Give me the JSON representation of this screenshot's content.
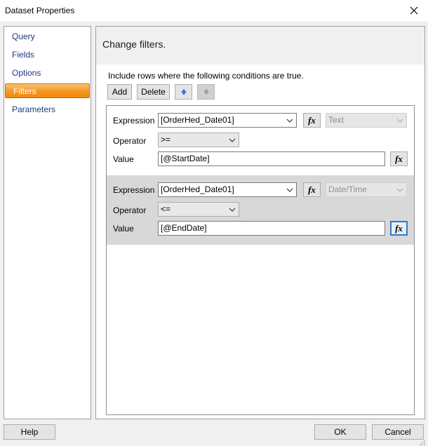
{
  "window": {
    "title": "Dataset Properties"
  },
  "nav": {
    "items": [
      {
        "label": "Query"
      },
      {
        "label": "Fields"
      },
      {
        "label": "Options"
      },
      {
        "label": "Filters",
        "selected": true
      },
      {
        "label": "Parameters"
      }
    ]
  },
  "panel": {
    "header": "Change filters.",
    "instructions": "Include rows where the following conditions are true."
  },
  "toolbar": {
    "add_label": "Add",
    "delete_label": "Delete",
    "move_up_icon": "arrow-up-icon",
    "move_down_icon": "arrow-down-icon"
  },
  "filters": [
    {
      "expression_label": "Expression",
      "expression_value": "[OrderHed_Date01]",
      "type_value": "Text",
      "operator_label": "Operator",
      "operator_value": ">=",
      "value_label": "Value",
      "value_value": "[@StartDate]",
      "fx_label": "fx"
    },
    {
      "expression_label": "Expression",
      "expression_value": "[OrderHed_Date01]",
      "type_value": "Date/Time",
      "operator_label": "Operator",
      "operator_value": "<=",
      "value_label": "Value",
      "value_value": "[@EndDate]",
      "fx_label": "fx"
    }
  ],
  "footer": {
    "help_label": "Help",
    "ok_label": "OK",
    "cancel_label": "Cancel"
  },
  "colors": {
    "nav_selected": "#f5961e",
    "nav_text": "#1e3a80",
    "focus_border": "#3377cc",
    "arrow_blue": "#2a6fd6"
  }
}
